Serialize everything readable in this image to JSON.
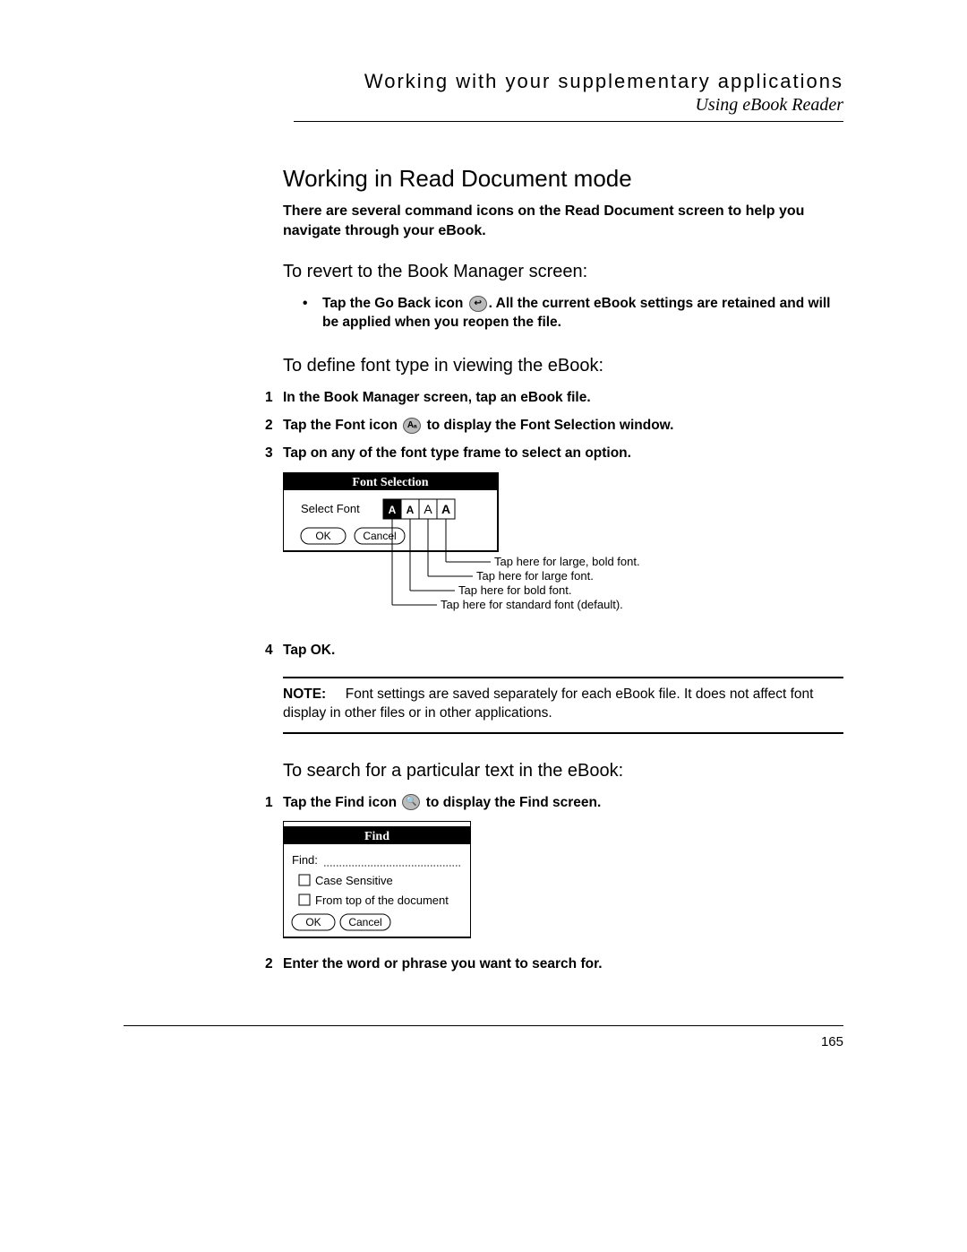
{
  "header": {
    "title": "Working with your supplementary applications",
    "subtitle": "Using eBook Reader"
  },
  "section": {
    "h1": "Working in Read Document mode",
    "intro": "There are several command icons on the Read Document screen to help you navigate through your eBook.",
    "revert": {
      "heading": "To revert to the Book Manager screen:",
      "bullet_pre": "Tap the Go Back icon ",
      "bullet_post": ". All the current eBook settings are retained and will be applied when you reopen the file."
    },
    "font": {
      "heading": "To define font type in viewing the eBook:",
      "steps": {
        "s1": "In the Book Manager screen, tap an eBook file.",
        "s2_pre": "Tap the Font icon ",
        "s2_post": " to display the Font Selection window.",
        "s3": "Tap on any of the font type frame to select an option.",
        "s4": "Tap OK."
      },
      "diagram": {
        "title": "Font Selection",
        "select_label": "Select Font",
        "ok": "OK",
        "cancel": "Cancel",
        "callouts": {
          "large_bold": "Tap here for large, bold font.",
          "large": "Tap here for large font.",
          "bold": "Tap here for bold font.",
          "standard": "Tap here for standard font (default)."
        }
      }
    },
    "note": {
      "label": "NOTE:",
      "body": "Font settings are saved separately for each eBook file. It does not affect font display in other files or in other applications."
    },
    "search": {
      "heading": "To search for a particular text in the eBook:",
      "steps": {
        "s1_pre": "Tap the Find icon ",
        "s1_post": " to display the Find screen.",
        "s2": "Enter the word or phrase you want to search for."
      },
      "diagram": {
        "title": "Find",
        "find_label": "Find:",
        "case_sensitive": "Case Sensitive",
        "from_top": "From top of the document",
        "ok": "OK",
        "cancel": "Cancel"
      }
    }
  },
  "page_number": "165"
}
